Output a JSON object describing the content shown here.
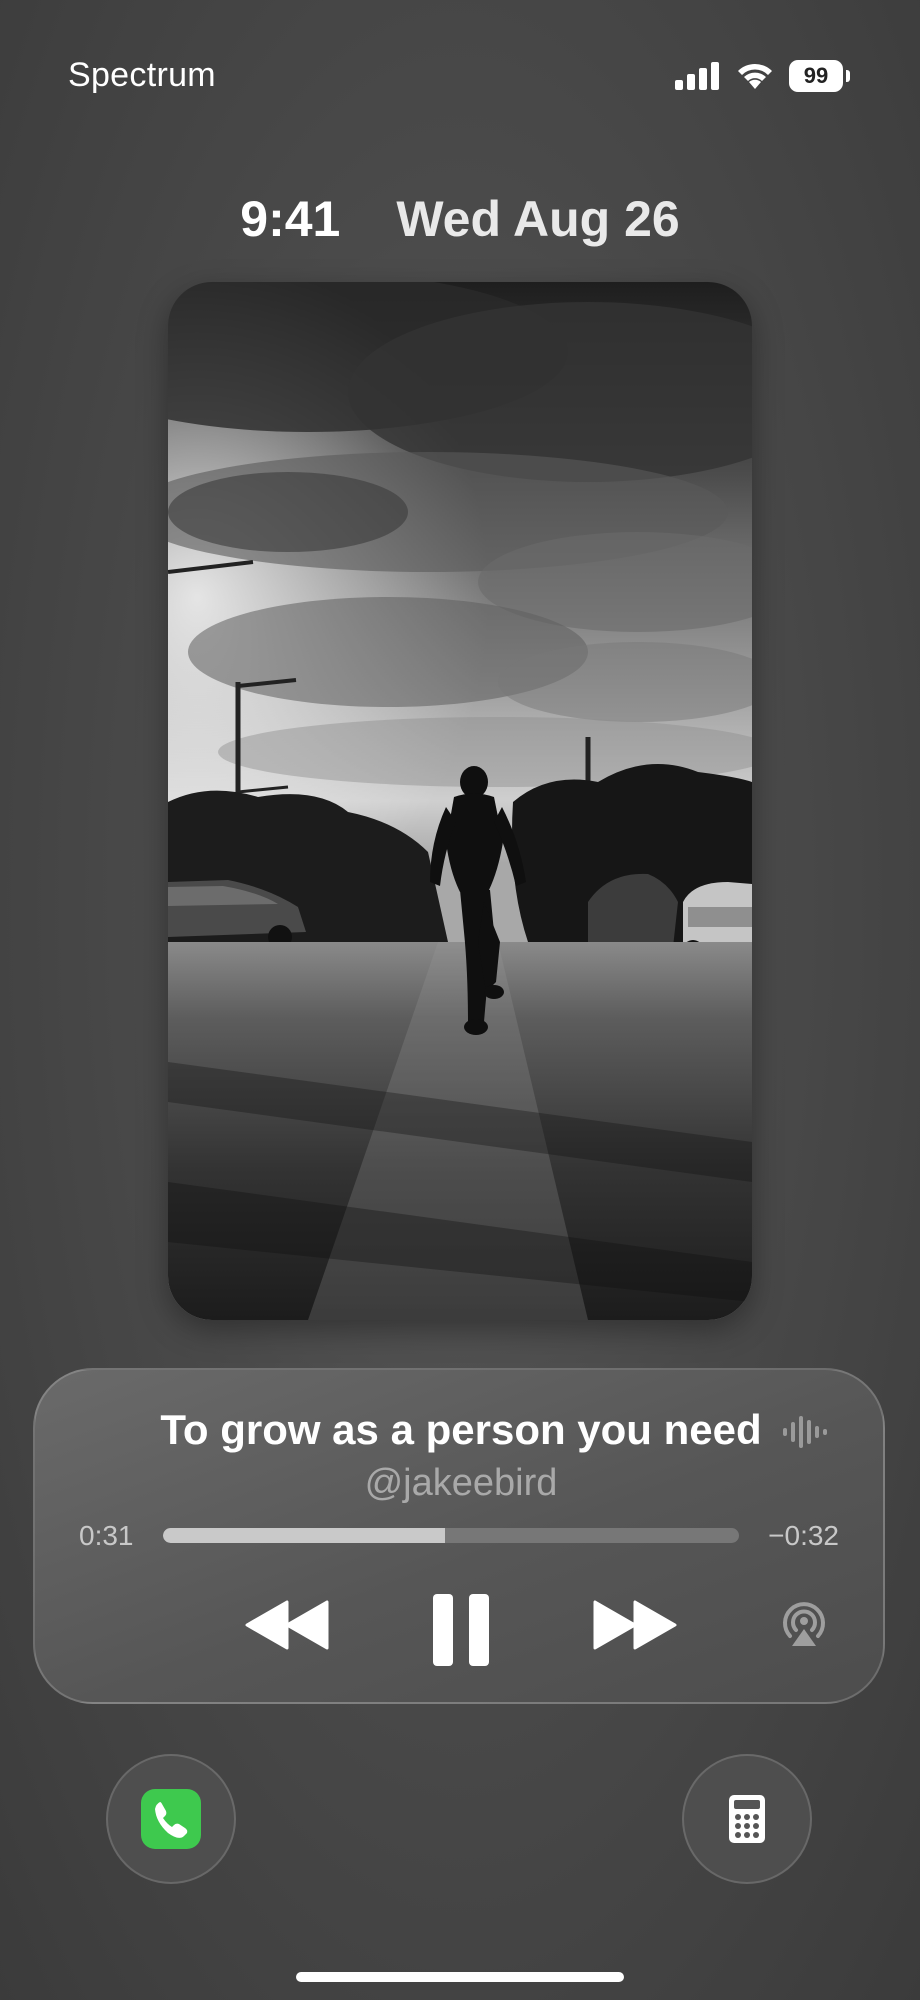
{
  "status_bar": {
    "carrier": "Spectrum",
    "battery_level": "99",
    "signal_bars": 4,
    "icons": [
      "cellular-signal-icon",
      "wifi-icon",
      "battery-icon"
    ]
  },
  "lock_screen": {
    "time": "9:41",
    "date": "Wed Aug 26"
  },
  "now_playing": {
    "title": "To grow as a person you need",
    "artist": "@jakeebird",
    "elapsed": "0:31",
    "remaining": "−0:32",
    "progress": 0.49,
    "controls": [
      "rewind-icon",
      "pause-icon",
      "fast-forward-icon",
      "airplay-icon"
    ]
  },
  "quick_actions": [
    {
      "name": "phone",
      "icon": "phone-icon",
      "color": "#3ec94e"
    },
    {
      "name": "calculator",
      "icon": "calculator-icon",
      "color": "#ffffff"
    }
  ]
}
